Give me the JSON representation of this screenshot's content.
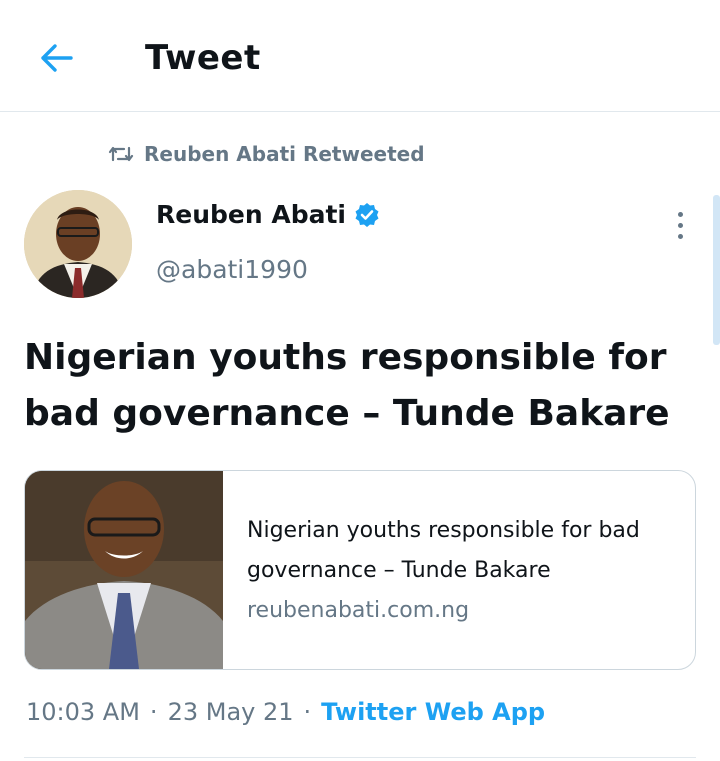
{
  "header": {
    "title": "Tweet",
    "back_icon": "arrow-left-icon"
  },
  "retweet": {
    "icon": "retweet-icon",
    "text": "Reuben Abati Retweeted"
  },
  "author": {
    "name": "Reuben Abati",
    "verified_icon": "verified-badge-icon",
    "handle": "@abati1990",
    "avatar": "avatar"
  },
  "tweet": {
    "text": "Nigerian youths responsible for bad governance – Tunde Bakare"
  },
  "card": {
    "title": "Nigerian youths responsible for bad governance – Tunde Bakare",
    "domain": "reubenabati.com.ng"
  },
  "meta": {
    "time": "10:03 AM",
    "sep1": "·",
    "date": "23 May 21",
    "sep2": "·",
    "source": "Twitter Web App"
  },
  "colors": {
    "accent": "#1da1f2",
    "muted": "#657786",
    "text": "#0f1419",
    "border": "#ccd6dd"
  }
}
